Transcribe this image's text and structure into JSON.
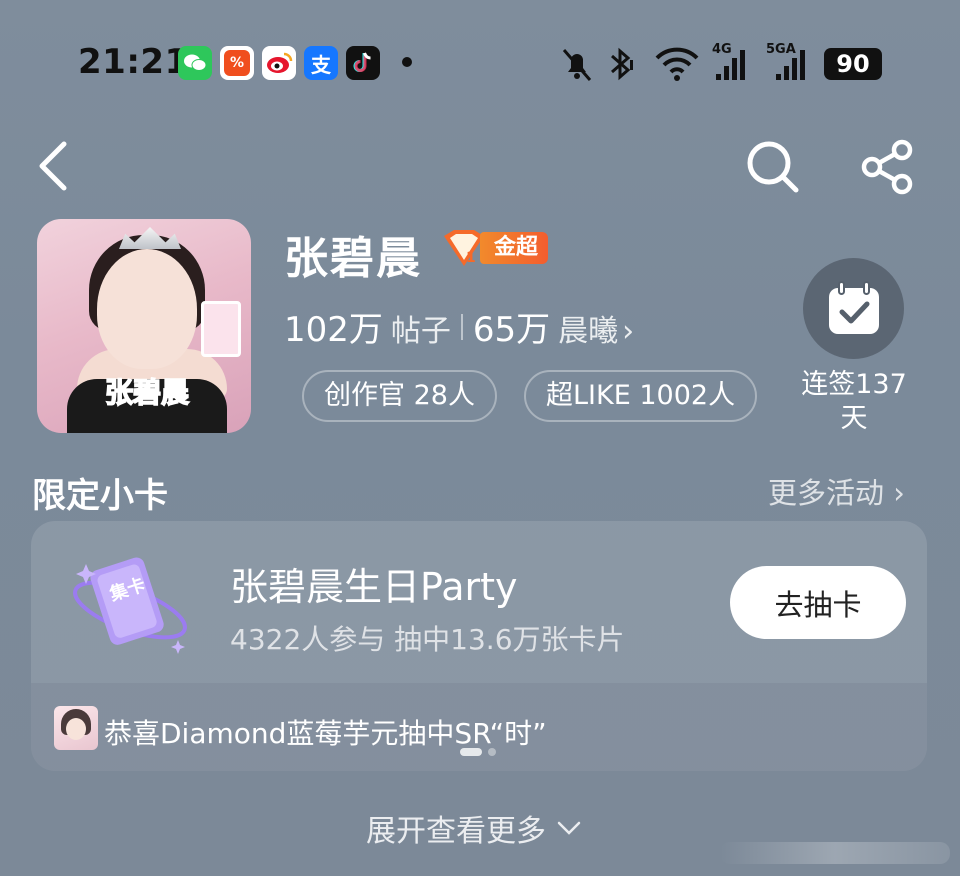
{
  "status_bar": {
    "time": "21:21",
    "apps": [
      {
        "icon": "wechat-icon",
        "color": "#2ec75b",
        "glyph": "💬"
      },
      {
        "icon": "taobao-flash-icon",
        "color": "#f04e1e",
        "glyph": "%"
      },
      {
        "icon": "weibo-icon",
        "color": "#f7c34a",
        "glyph": "◉"
      },
      {
        "icon": "alipay-icon",
        "color": "#1677ff",
        "glyph": "支"
      },
      {
        "icon": "tiktok-icon",
        "color": "#111111",
        "glyph": "♪"
      }
    ],
    "network_4g": "4G",
    "network_5g": "5GA",
    "battery": "90"
  },
  "profile": {
    "name": "张碧晨",
    "badge_label": "金超",
    "badge_level": "1",
    "posts_count": "102万",
    "posts_label": "帖子",
    "fans_count": "65万",
    "fans_label": "晨曦",
    "avatar_sticker": "张碧晨",
    "creators_pill": "创作官 28人",
    "superlike_pill": "超LIKE 1002人",
    "checkin_label": "连签137天"
  },
  "section": {
    "title": "限定小卡",
    "more_label": "更多活动",
    "card_icon_text": "集卡",
    "event_title": "张碧晨生日Party",
    "event_sub": "4322人参与 抽中13.6万张卡片",
    "draw_button": "去抽卡",
    "ticker": "恭喜Diamond蓝莓芋元抽中SR“时”"
  },
  "footer": {
    "expand_label": "展开查看更多"
  },
  "colors": {
    "background": "#7f8d9c",
    "badge_orange": "#f35d2e",
    "button_white": "#ffffff"
  }
}
